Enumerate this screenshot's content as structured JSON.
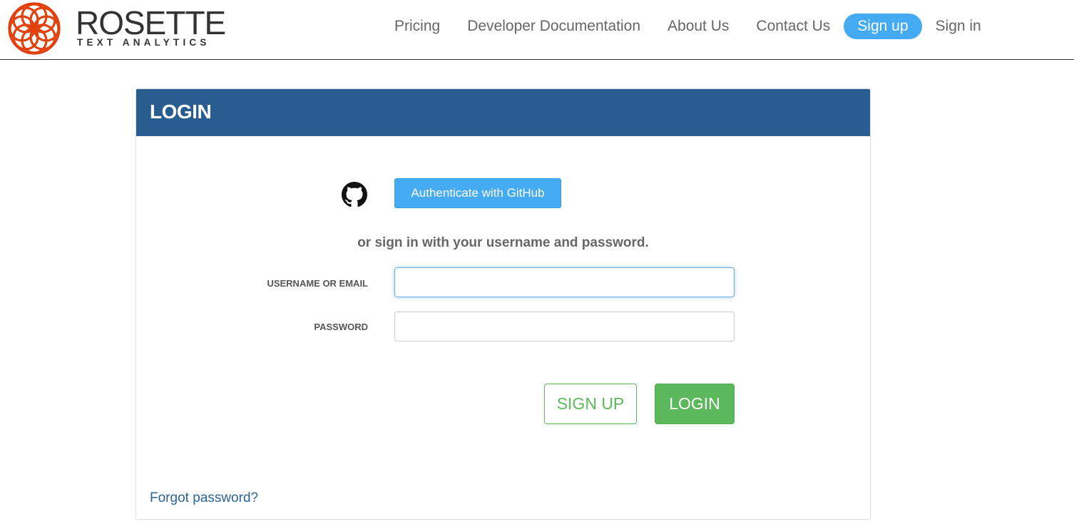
{
  "header": {
    "logo": {
      "name": "ROSETTE",
      "tagline": "TEXT ANALYTICS",
      "icon": "rosette-logo-icon",
      "color": "#e2400c"
    },
    "nav": {
      "pricing": "Pricing",
      "developer_docs": "Developer Documentation",
      "about": "About Us",
      "contact": "Contact Us",
      "signup": "Sign up",
      "signin": "Sign in"
    }
  },
  "login_panel": {
    "title": "LOGIN",
    "github_icon": "github-icon",
    "github_button": "Authenticate with GitHub",
    "or_text": "or sign in with your username and password.",
    "username": {
      "label": "USERNAME OR EMAIL",
      "value": "",
      "placeholder": ""
    },
    "password": {
      "label": "PASSWORD",
      "value": "",
      "placeholder": ""
    },
    "signup_button": "SIGN UP",
    "login_button": "LOGIN",
    "forgot_link": "Forgot password?"
  },
  "colors": {
    "panel_header": "#2a5d8f",
    "accent_blue": "#44abf2",
    "success_green": "#5cb85c",
    "link": "#2a6496"
  }
}
